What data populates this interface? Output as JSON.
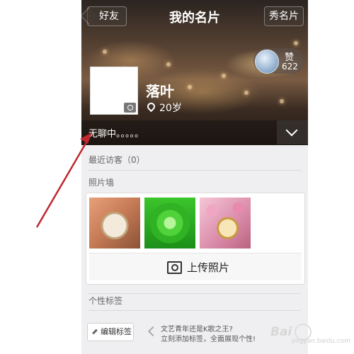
{
  "header": {
    "back_label": "好友",
    "title": "我的名片",
    "show_label": "秀名片"
  },
  "profile": {
    "like_label": "赞",
    "like_count": "622",
    "name": "落叶",
    "age": "20岁",
    "status": "无聊中。。。。。"
  },
  "sections": {
    "recent_visitors": "最近访客（0）",
    "photo_wall": "照片墙",
    "upload_label": "上传照片",
    "tags": "个性标签",
    "edit_tags_label": "编辑标签",
    "tags_hint_line1": "文艺青年还是K歌之王?",
    "tags_hint_line2": "立刻添加标签，全面展现个性!"
  },
  "watermark": {
    "text": "Bai",
    "sub": "jingyan.baidu.com"
  },
  "colors": {
    "annotation_arrow": "#c0282d"
  }
}
